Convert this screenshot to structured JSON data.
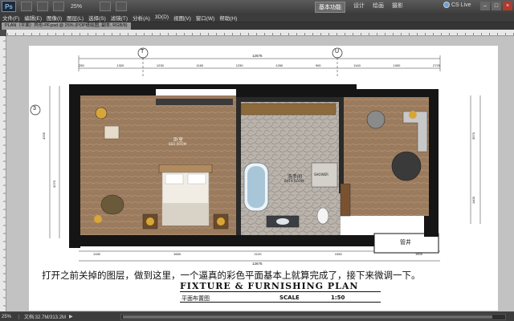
{
  "titlebar": {
    "app_logo": "Ps",
    "zoom": "25%",
    "workspaces": [
      "基本功能",
      "设计",
      "绘画",
      "摄影"
    ],
    "active_workspace": 0,
    "cslive": "CS Live",
    "window_controls": [
      "–",
      "□",
      "×"
    ]
  },
  "menu": [
    "文件(F)",
    "编辑(E)",
    "图像(I)",
    "图层(L)",
    "选择(S)",
    "滤镜(T)",
    "分析(A)",
    "3D(D)",
    "视图(V)",
    "窗口(W)",
    "帮助(H)"
  ],
  "doc_tab": "PLAN（平面）异形-PF.psd @ 25% (POP纸绘图, 副本, RGB/8)",
  "drawing": {
    "grid_bubbles": [
      "T",
      "U",
      "3"
    ],
    "top_total_dim": "12675",
    "top_dims": [
      "250",
      "1320",
      "1230",
      "1160",
      "1230",
      "1260",
      "900",
      "1140",
      "1000",
      "2725"
    ],
    "bottom_dims": [
      "1330",
      "3600",
      "2120",
      "1050",
      "1500"
    ],
    "bottom_total_dim": "12675",
    "left_dims": [
      "4295",
      "3270"
    ],
    "right_dims": [
      "3570",
      "1400"
    ],
    "labels": {
      "bedroom": "卧室",
      "bedroom_en": "BED ROOM",
      "bathroom": "洗手间",
      "bathroom_en": "BATH ROOM",
      "shower": "SHOWER",
      "pipe_shaft": "管井"
    }
  },
  "caption": "打开之前关掉的图层，做到这里，一个逼真的彩色平面基本上就算完成了，接下来微调一下。",
  "plan_title": "FIXTURE & FURNISHING PLAN",
  "plan_subtitle": "平面布置图",
  "scale_label": "SCALE",
  "scale_value": "1:50",
  "status": {
    "zoom": "25%",
    "doc": "文档:32.7M/313.2M",
    "arrow": "▶"
  },
  "colors": {
    "ui_dark": "#3c3c3c",
    "wall": "#111111",
    "wood_floor": "#9a7a5c",
    "stone_floor": "#b8b2aa",
    "accent_chair": "#6a5a3a"
  }
}
